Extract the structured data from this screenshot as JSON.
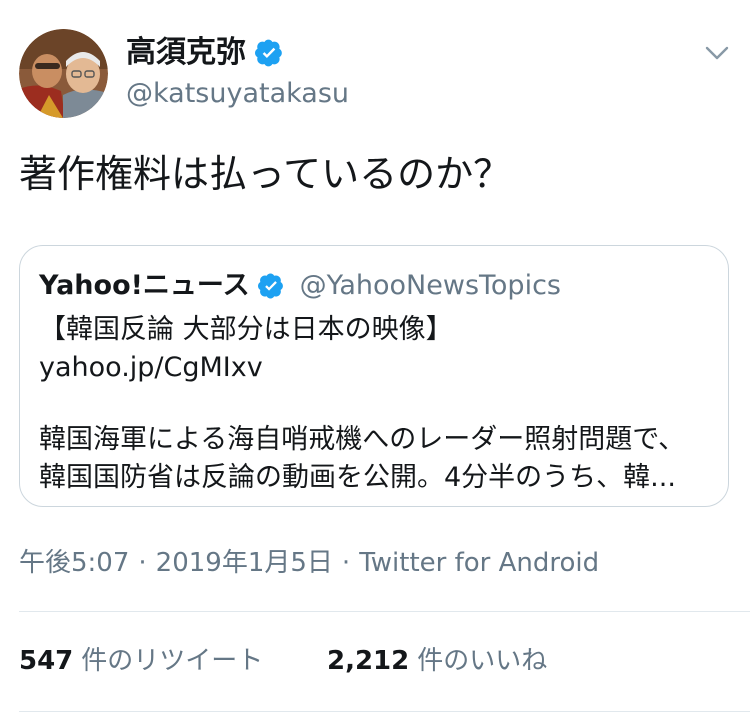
{
  "author": {
    "display_name": "高須克弥",
    "handle": "@katsuyatakasu",
    "verified": true
  },
  "tweet": {
    "text": "著作権料は払っているのか？"
  },
  "quoted_tweet": {
    "display_name": "Yahoo!ニュース",
    "handle": "@YahooNewsTopics",
    "verified": true,
    "title": "【韓国反論 大部分は日本の映像】",
    "link": "yahoo.jp/CgMIxv",
    "body_line_1": "韓国海軍による海自哨戒機へのレーダー照射問題で、",
    "body_line_2": "韓国国防省は反論の動画を公開。4分半のうち、韓..."
  },
  "meta": {
    "time": "午後5:07",
    "separator": "·",
    "date": "2019年1月5日",
    "source": "Twitter for Android"
  },
  "stats": {
    "retweets_count": "547",
    "retweets_label": "件のリツイート",
    "likes_count": "2,212",
    "likes_label": "件のいいね"
  },
  "icons": {
    "verified": "verified-badge-icon",
    "menu": "chevron-down-icon"
  },
  "colors": {
    "text_primary": "#14171a",
    "text_secondary": "#657786",
    "verified_blue": "#1da1f2",
    "border": "#ccd6dd",
    "divider": "#e1e8ed"
  }
}
